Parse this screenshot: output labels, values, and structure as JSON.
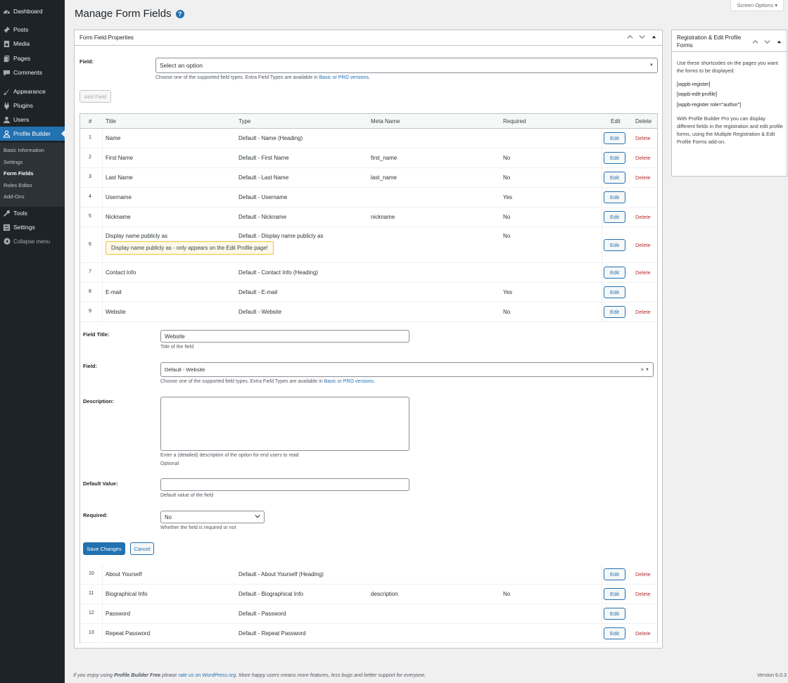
{
  "sidebar": {
    "items": [
      {
        "label": "Dashboard",
        "icon": "dashboard-icon"
      },
      {
        "label": "Posts",
        "icon": "pin-icon"
      },
      {
        "label": "Media",
        "icon": "media-icon"
      },
      {
        "label": "Pages",
        "icon": "pages-icon"
      },
      {
        "label": "Comments",
        "icon": "comment-icon"
      },
      {
        "label": "Appearance",
        "icon": "brush-icon"
      },
      {
        "label": "Plugins",
        "icon": "plugin-icon"
      },
      {
        "label": "Users",
        "icon": "users-icon"
      },
      {
        "label": "Profile Builder",
        "icon": "user-icon"
      },
      {
        "label": "Tools",
        "icon": "wrench-icon"
      },
      {
        "label": "Settings",
        "icon": "settings-icon"
      },
      {
        "label": "Collapse menu",
        "icon": "collapse-icon"
      }
    ],
    "submenu": [
      "Basic Information",
      "Settings",
      "Form Fields",
      "Roles Editor",
      "Add-Ons"
    ]
  },
  "screen_options": "Screen Options ▾",
  "page_title": "Manage Form Fields",
  "help_glyph": "?",
  "main_box": {
    "title": "Form Field Properties",
    "field_label": "Field:",
    "field_placeholder": "Select an option",
    "field_desc_prefix": "Choose one of the supported field types. Extra Field Types are available in ",
    "field_desc_link": "Basic or PRO versions",
    "field_desc_suffix": ".",
    "add_field_button": "Add Field"
  },
  "table": {
    "headers": {
      "num": "#",
      "title": "Title",
      "type": "Type",
      "meta": "Meta Name",
      "required": "Required",
      "edit": "Edit",
      "delete": "Delete"
    },
    "edit_label": "Edit",
    "delete_label": "Delete",
    "rows_top": [
      {
        "num": "1",
        "title": "Name",
        "type": "Default - Name (Heading)",
        "meta": "",
        "required": "",
        "delete": true
      },
      {
        "num": "2",
        "title": "First Name",
        "type": "Default - First Name",
        "meta": "first_name",
        "required": "No",
        "delete": true
      },
      {
        "num": "3",
        "title": "Last Name",
        "type": "Default - Last Name",
        "meta": "last_name",
        "required": "No",
        "delete": true
      },
      {
        "num": "4",
        "title": "Username",
        "type": "Default - Username",
        "meta": "",
        "required": "Yes",
        "delete": false
      },
      {
        "num": "5",
        "title": "Nickname",
        "type": "Default - Nickname",
        "meta": "nickname",
        "required": "No",
        "delete": true
      },
      {
        "num": "6",
        "title": "Display name publicly as",
        "type": "Default - Display name publicly as",
        "meta": "",
        "required": "No",
        "delete": true
      },
      {
        "num": "7",
        "title": "Contact Info",
        "type": "Default - Contact Info (Heading)",
        "meta": "",
        "required": "",
        "delete": true
      },
      {
        "num": "8",
        "title": "E-mail",
        "type": "Default - E-mail",
        "meta": "",
        "required": "Yes",
        "delete": false
      },
      {
        "num": "9",
        "title": "Website",
        "type": "Default - Website",
        "meta": "",
        "required": "No",
        "delete": true
      }
    ],
    "tooltip": "Display name publicly as - only appears on the Edit Profile page!",
    "rows_bottom": [
      {
        "num": "10",
        "title": "About Yourself",
        "type": "Default - About Yourself (Heading)",
        "meta": "",
        "required": "",
        "delete": true
      },
      {
        "num": "11",
        "title": "Biographical Info",
        "type": "Default - Biographical Info",
        "meta": "description",
        "required": "No",
        "delete": true
      },
      {
        "num": "12",
        "title": "Password",
        "type": "Default - Password",
        "meta": "",
        "required": "",
        "delete": false
      },
      {
        "num": "13",
        "title": "Repeat Password",
        "type": "Default - Repeat Password",
        "meta": "",
        "required": "",
        "delete": true
      }
    ]
  },
  "edit_form": {
    "field_title_label": "Field Title:",
    "field_title_value": "Website",
    "field_title_desc": "Title of the field",
    "field_label": "Field:",
    "field_value": "Default - Website",
    "field_clear": "×",
    "field_desc_prefix": "Choose one of the supported field types. Extra Field Types are available in ",
    "field_desc_link": "Basic or PRO versions",
    "field_desc_suffix": ".",
    "description_label": "Description:",
    "description_desc": "Enter a (detailed) description of the option for end users to read",
    "description_optional": "Optional",
    "default_value_label": "Default Value:",
    "default_value_desc": "Default value of the field",
    "required_label": "Required:",
    "required_value": "No",
    "required_desc": "Whether the field is required or not",
    "save_button": "Save Changes",
    "cancel_button": "Cancel"
  },
  "side_box": {
    "title": "Registration & Edit Profile Forms",
    "intro": "Use these shortcodes on the pages you want the forms to be displayed:",
    "shortcodes": [
      "[wppb-register]",
      "[wppb-edit-profile]",
      "[wppb-register role=\"author\"]"
    ],
    "pro_text": "With Profile Builder Pro you can display different fields in the registration and edit profile forms, using the Multiple Registration & Edit Profile Forms add-on."
  },
  "footer": {
    "prefix": "If you enjoy using ",
    "brand": "Profile Builder Free",
    "middle": " please ",
    "link": "rate us on WordPress.org",
    "suffix": ". More happy users means more features, less bugs and better support for everyone.",
    "version": "Version 6.0.3"
  }
}
